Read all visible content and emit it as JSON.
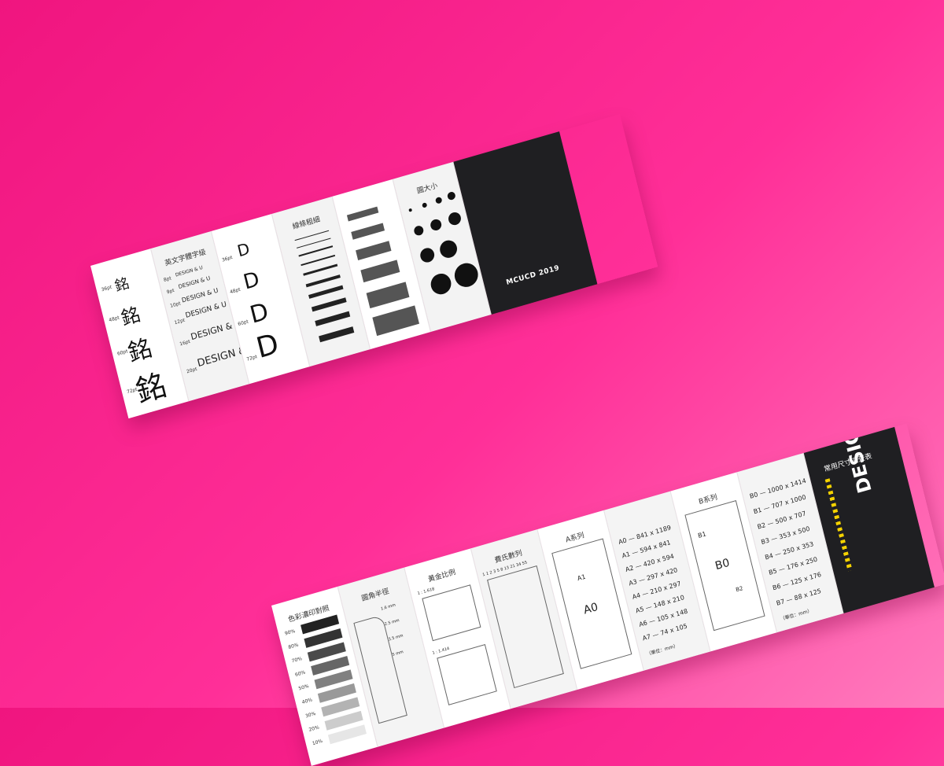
{
  "scene": {
    "background_color": "#ff2f98",
    "brochure1": {
      "panels": [
        {
          "type": "font-sizes",
          "labels": [
            "36pt",
            "48pt",
            "60pt",
            "72pt"
          ],
          "glyph": "銘"
        },
        {
          "type": "text-sizes",
          "title": "英文字體字級",
          "labels": [
            "8pt",
            "9pt",
            "10pt",
            "12pt",
            "14pt",
            "16pt",
            "18pt",
            "20pt",
            "24pt"
          ],
          "sample": "DESIGN & U"
        },
        {
          "type": "letter-sizes",
          "labels": [
            "36pt",
            "48pt",
            "60pt",
            "72pt"
          ],
          "glyph": "D"
        },
        {
          "type": "line-weights",
          "title": "線條粗細",
          "labels": [
            "0.25pt",
            "0.5pt",
            "0.75pt",
            "1pt",
            "2pt",
            "3pt",
            "4pt",
            "5pt",
            "6pt",
            "8pt",
            "10pt",
            "12pt"
          ]
        },
        {
          "type": "bar-sizes",
          "labels": [
            "14pt",
            "18pt",
            "20pt",
            "24pt",
            "28pt",
            "36pt"
          ]
        },
        {
          "type": "dot-sizes",
          "title": "圓大小",
          "labels": [
            "3mm",
            "4mm",
            "5mm",
            "6mm",
            "7mm",
            "8mm",
            "9mm",
            "10mm",
            "12mm",
            "14mm",
            "15mm",
            "16mm",
            "18mm",
            "20mm"
          ]
        },
        {
          "type": "cover",
          "text": "MCUCD 2019"
        }
      ]
    },
    "brochure2": {
      "panels": [
        {
          "type": "shading",
          "title": "色彩濃印對照",
          "percents": [
            "90%",
            "80%",
            "70%",
            "60%",
            "50%",
            "40%",
            "30%",
            "20%",
            "10%"
          ]
        },
        {
          "type": "radii",
          "title": "圓角半徑",
          "labels": [
            "1.6 mm",
            "2.5 mm",
            "3.5 mm",
            "5 mm"
          ]
        },
        {
          "type": "golden",
          "title": "黃金比例",
          "labels": [
            "1 : 1.618",
            "1 : 1.414"
          ]
        },
        {
          "type": "fibonacci",
          "title": "費氏數列",
          "sequence": "1 1 2 3 5 8 13 21 34 55"
        },
        {
          "type": "a-diagram",
          "title": "A系列",
          "labels": [
            "A0",
            "A1",
            "A2",
            "A3",
            "A4",
            "A5"
          ]
        },
        {
          "type": "a-sizes",
          "rows": [
            "A0 — 841 x 1189",
            "A1 — 594 x 841",
            "A2 — 420 x 594",
            "A3 — 297 x 420",
            "A4 — 210 x 297",
            "A5 — 148 x 210",
            "A6 — 105 x 148",
            "A7 — 74 x 105"
          ],
          "unit": "（單位：mm）"
        },
        {
          "type": "b-diagram",
          "title": "B系列",
          "labels": [
            "B0",
            "B1",
            "B2"
          ]
        },
        {
          "type": "b-sizes",
          "rows": [
            "B0 — 1000 x 1414",
            "B1 — 707 x 1000",
            "B2 — 500 x 707",
            "B3 — 353 x 500",
            "B4 — 250 x 353",
            "B5 — 176 x 250",
            "B6 — 125 x 176",
            "B7 — 88 x 125"
          ],
          "unit": "（單位：mm）"
        },
        {
          "type": "cover",
          "title": "常用尺寸速查表",
          "text": "DESIGN & U",
          "accent": "#f4d200"
        }
      ]
    }
  }
}
